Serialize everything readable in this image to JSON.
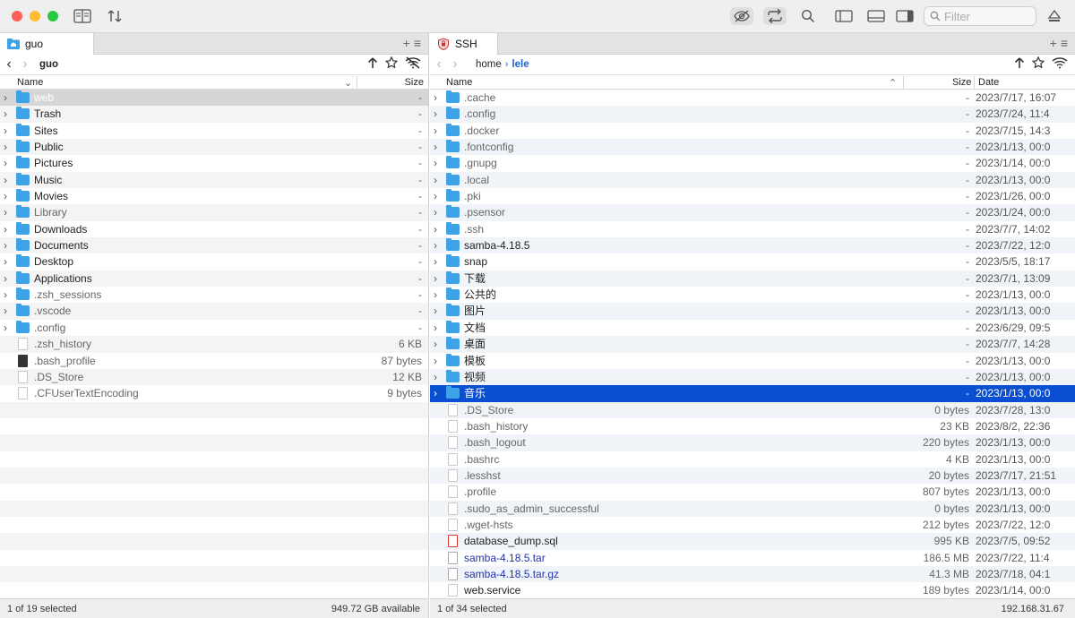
{
  "toolbar": {
    "search_placeholder": "Filter",
    "icons": [
      "bookmarks-icon",
      "sort-icon",
      "hidden-files-icon",
      "sync-icon",
      "search-icon",
      "sidebar-left-icon",
      "panel-bottom-icon",
      "sidebar-right-icon",
      "eject-icon"
    ]
  },
  "colors": {
    "accent": "#0a4fd1",
    "folder": "#3ea2e9",
    "link": "#1a66d9"
  },
  "left": {
    "tab_label": "guo",
    "path": [
      "guo"
    ],
    "columns": {
      "name": "Name",
      "size": "Size"
    },
    "rows": [
      {
        "name": "web",
        "size": "-",
        "type": "folder"
      },
      {
        "name": "Trash",
        "size": "-",
        "type": "folder"
      },
      {
        "name": "Sites",
        "size": "-",
        "type": "folder"
      },
      {
        "name": "Public",
        "size": "-",
        "type": "folder"
      },
      {
        "name": "Pictures",
        "size": "-",
        "type": "folder"
      },
      {
        "name": "Music",
        "size": "-",
        "type": "folder"
      },
      {
        "name": "Movies",
        "size": "-",
        "type": "folder"
      },
      {
        "name": "Library",
        "size": "-",
        "type": "folder"
      },
      {
        "name": "Downloads",
        "size": "-",
        "type": "folder"
      },
      {
        "name": "Documents",
        "size": "-",
        "type": "folder"
      },
      {
        "name": "Desktop",
        "size": "-",
        "type": "folder"
      },
      {
        "name": "Applications",
        "size": "-",
        "type": "folder"
      },
      {
        "name": ".zsh_sessions",
        "size": "-",
        "type": "folder"
      },
      {
        "name": ".vscode",
        "size": "-",
        "type": "folder"
      },
      {
        "name": ".config",
        "size": "-",
        "type": "folder"
      },
      {
        "name": ".zsh_history",
        "size": "6 KB",
        "type": "file"
      },
      {
        "name": ".bash_profile",
        "size": "87 bytes",
        "type": "file"
      },
      {
        "name": ".DS_Store",
        "size": "12 KB",
        "type": "file"
      },
      {
        "name": ".CFUserTextEncoding",
        "size": "9 bytes",
        "type": "file"
      }
    ],
    "status_selected": "1 of 19 selected",
    "status_available": "949.72 GB available"
  },
  "right": {
    "tab_label": "SSH",
    "path": [
      "home",
      "lele"
    ],
    "columns": {
      "name": "Name",
      "size": "Size",
      "date": "Date"
    },
    "rows": [
      {
        "name": ".cache",
        "size": "-",
        "date": "2023/7/17, 16:07",
        "type": "folder"
      },
      {
        "name": ".config",
        "size": "-",
        "date": "2023/7/24, 11:4",
        "type": "folder"
      },
      {
        "name": ".docker",
        "size": "-",
        "date": "2023/7/15, 14:3",
        "type": "folder"
      },
      {
        "name": ".fontconfig",
        "size": "-",
        "date": "2023/1/13, 00:0",
        "type": "folder"
      },
      {
        "name": ".gnupg",
        "size": "-",
        "date": "2023/1/14, 00:0",
        "type": "folder"
      },
      {
        "name": ".local",
        "size": "-",
        "date": "2023/1/13, 00:0",
        "type": "folder"
      },
      {
        "name": ".pki",
        "size": "-",
        "date": "2023/1/26, 00:0",
        "type": "folder"
      },
      {
        "name": ".psensor",
        "size": "-",
        "date": "2023/1/24, 00:0",
        "type": "folder"
      },
      {
        "name": ".ssh",
        "size": "-",
        "date": "2023/7/7, 14:02",
        "type": "folder"
      },
      {
        "name": "samba-4.18.5",
        "size": "-",
        "date": "2023/7/22, 12:0",
        "type": "folder"
      },
      {
        "name": "snap",
        "size": "-",
        "date": "2023/5/5, 18:17",
        "type": "folder"
      },
      {
        "name": "下载",
        "size": "-",
        "date": "2023/7/1, 13:09",
        "type": "folder"
      },
      {
        "name": "公共的",
        "size": "-",
        "date": "2023/1/13, 00:0",
        "type": "folder"
      },
      {
        "name": "图片",
        "size": "-",
        "date": "2023/1/13, 00:0",
        "type": "folder"
      },
      {
        "name": "文档",
        "size": "-",
        "date": "2023/6/29, 09:5",
        "type": "folder"
      },
      {
        "name": "桌面",
        "size": "-",
        "date": "2023/7/7, 14:28",
        "type": "folder"
      },
      {
        "name": "模板",
        "size": "-",
        "date": "2023/1/13, 00:0",
        "type": "folder"
      },
      {
        "name": "视频",
        "size": "-",
        "date": "2023/1/13, 00:0",
        "type": "folder"
      },
      {
        "name": "音乐",
        "size": "-",
        "date": "2023/1/13, 00:0",
        "type": "folder"
      },
      {
        "name": ".DS_Store",
        "size": "0 bytes",
        "date": "2023/7/28, 13:0",
        "type": "file"
      },
      {
        "name": ".bash_history",
        "size": "23 KB",
        "date": "2023/8/2, 22:36",
        "type": "file"
      },
      {
        "name": ".bash_logout",
        "size": "220 bytes",
        "date": "2023/1/13, 00:0",
        "type": "file"
      },
      {
        "name": ".bashrc",
        "size": "4 KB",
        "date": "2023/1/13, 00:0",
        "type": "file"
      },
      {
        "name": ".lesshst",
        "size": "20 bytes",
        "date": "2023/7/17, 21:51",
        "type": "file"
      },
      {
        "name": ".profile",
        "size": "807 bytes",
        "date": "2023/1/13, 00:0",
        "type": "file"
      },
      {
        "name": ".sudo_as_admin_successful",
        "size": "0 bytes",
        "date": "2023/1/13, 00:0",
        "type": "file"
      },
      {
        "name": ".wget-hsts",
        "size": "212 bytes",
        "date": "2023/7/22, 12:0",
        "type": "file"
      },
      {
        "name": "database_dump.sql",
        "size": "995 KB",
        "date": "2023/7/5, 09:52",
        "type": "sql"
      },
      {
        "name": "samba-4.18.5.tar",
        "size": "186.5 MB",
        "date": "2023/7/22, 11:4",
        "type": "archive"
      },
      {
        "name": "samba-4.18.5.tar.gz",
        "size": "41.3 MB",
        "date": "2023/7/18, 04:1",
        "type": "archive"
      },
      {
        "name": "web.service",
        "size": "189 bytes",
        "date": "2023/1/14, 00:0",
        "type": "file"
      }
    ],
    "status_selected": "1 of 34 selected",
    "status_host": "192.168.31.67"
  }
}
